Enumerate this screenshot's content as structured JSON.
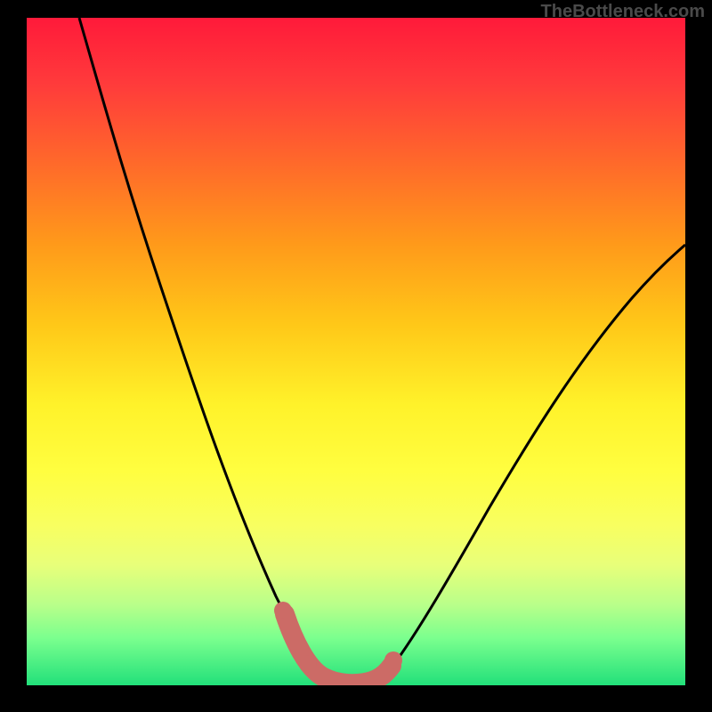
{
  "watermark": "TheBottleneck.com",
  "chart_data": {
    "type": "line",
    "title": "",
    "xlabel": "",
    "ylabel": "",
    "xlim": [
      0,
      100
    ],
    "ylim": [
      0,
      100
    ],
    "series": [
      {
        "name": "curve",
        "x": [
          8,
          12,
          16,
          20,
          24,
          28,
          32,
          36,
          38,
          40,
          42,
          44,
          46,
          48,
          52,
          56,
          60,
          65,
          70,
          75,
          80,
          85,
          90,
          95,
          100
        ],
        "y": [
          100,
          87,
          74,
          62,
          51,
          41,
          32,
          23,
          18,
          12,
          7,
          3,
          1,
          1,
          1,
          3,
          8,
          15,
          23,
          31,
          39,
          46,
          53,
          59,
          64
        ]
      },
      {
        "name": "highlight",
        "x": [
          38,
          40,
          42,
          44,
          46,
          48,
          50,
          52,
          54
        ],
        "y": [
          11,
          6,
          3,
          1.5,
          1,
          1,
          1,
          2,
          5
        ]
      }
    ],
    "colors": {
      "curve": "#000000",
      "highlight": "#cc6b66"
    }
  }
}
